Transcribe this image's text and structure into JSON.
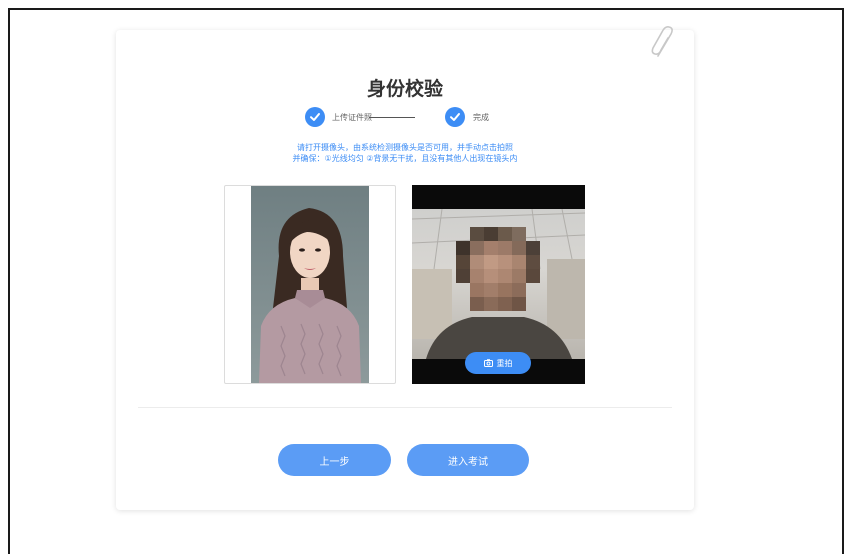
{
  "page": {
    "title": "身份校验"
  },
  "steps": [
    {
      "label": "上传证件照",
      "status": "done"
    },
    {
      "label": "完成",
      "status": "done"
    }
  ],
  "instructions": {
    "line1": "请打开摄像头，由系统检测摄像头是否可用，并手动点击拍照",
    "line2": "并确保：①光线均匀 ②背景无干扰，且没有其他人出现在镜头内"
  },
  "camera": {
    "retake_label": "重拍"
  },
  "actions": {
    "prev_label": "上一步",
    "enter_label": "进入考试"
  },
  "colors": {
    "accent": "#3d8df5",
    "button": "#5b9cf5",
    "title": "#333333"
  },
  "icons": [
    "paperclip-icon",
    "check-icon",
    "camera-icon"
  ]
}
